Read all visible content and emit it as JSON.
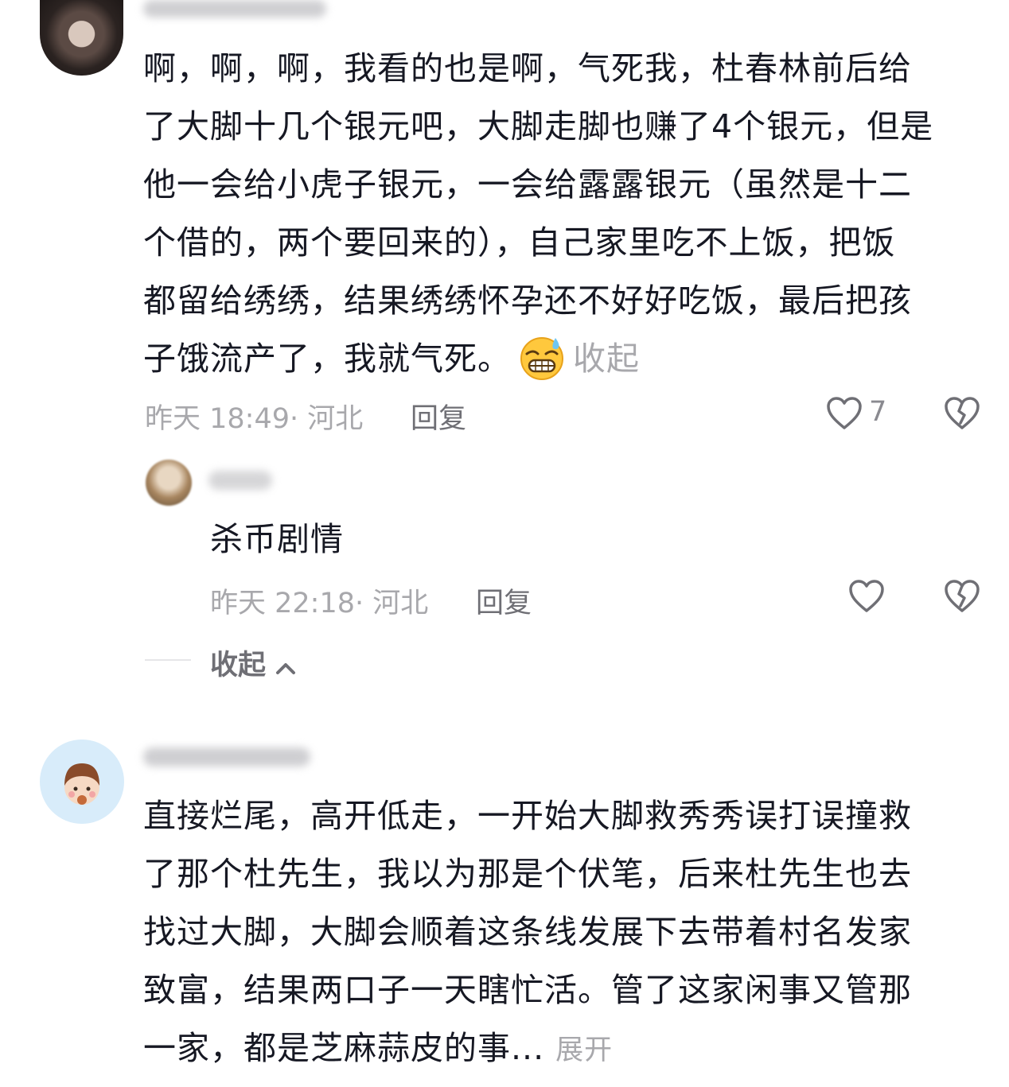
{
  "comment1": {
    "lines": [
      "啊，啊，啊，我看的也是啊，气死我，杜春林前后给",
      "了大脚十几个银元吧，大脚走脚也赚了4个银元，但是",
      "他一会给小虎子银元，一会给露露银元（虽然是十二",
      "个借的，两个要回来的），自己家里吃不上饭，把饭",
      "都留给绣绣，结果绣绣怀孕还不好好吃饭，最后把孩",
      "子饿流产了，我就气死。"
    ],
    "collapse_label": "收起",
    "meta": "昨天 18:49· 河北",
    "reply_label": "回复",
    "like_count": "7",
    "emoji_icon": "grinning-sweat-emoji"
  },
  "reply1": {
    "text": "杀币剧情",
    "meta": "昨天 22:18· 河北",
    "reply_label": "回复"
  },
  "thread": {
    "collapse_label": "收起",
    "collapse_icon": "chevron-up-icon"
  },
  "comment2": {
    "lines": [
      "直接烂尾，高开低走，一开始大脚救秀秀误打误撞救",
      "了那个杜先生，我以为那是个伏笔，后来杜先生也去",
      "找过大脚，大脚会顺着这条线发展下去带着村名发家",
      "致富，结果两口子一天瞎忙活。管了这家闲事又管那",
      "一家，都是芝麻蒜皮的事..."
    ],
    "expand_label": "展开"
  },
  "colors": {
    "text": "#161823",
    "muted": "#a8a8ac",
    "reply": "#6f6f75"
  }
}
